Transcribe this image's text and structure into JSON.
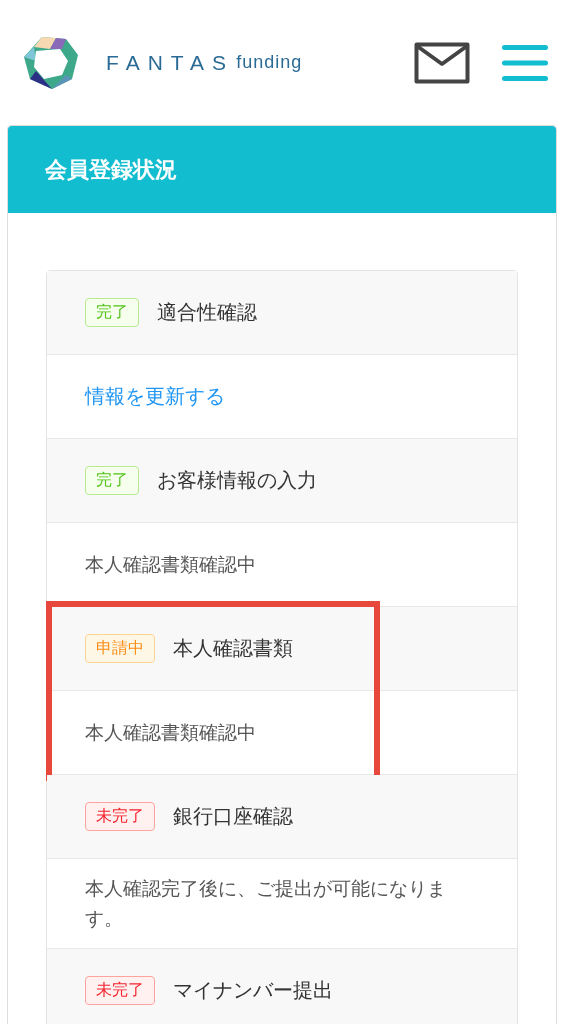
{
  "header": {
    "logo_main": "FANTAS",
    "logo_sub": "funding"
  },
  "panel": {
    "title": "会員登録状況"
  },
  "steps": [
    {
      "kind": "done",
      "status_label": "完了",
      "title": "適合性確認",
      "link": "情報を更新する",
      "highlighted": false
    },
    {
      "kind": "done",
      "status_label": "完了",
      "title": "お客様情報の入力",
      "detail": "本人確認書類確認中",
      "highlighted": false
    },
    {
      "kind": "pending",
      "status_label": "申請中",
      "title": "本人確認書類",
      "detail": "本人確認書類確認中",
      "highlighted": true
    },
    {
      "kind": "incomplete",
      "status_label": "未完了",
      "title": "銀行口座確認",
      "detail": "本人確認完了後に、ご提出が可能になります。",
      "highlighted": false
    },
    {
      "kind": "incomplete",
      "status_label": "未完了",
      "title": "マイナンバー提出",
      "highlighted": false
    }
  ]
}
